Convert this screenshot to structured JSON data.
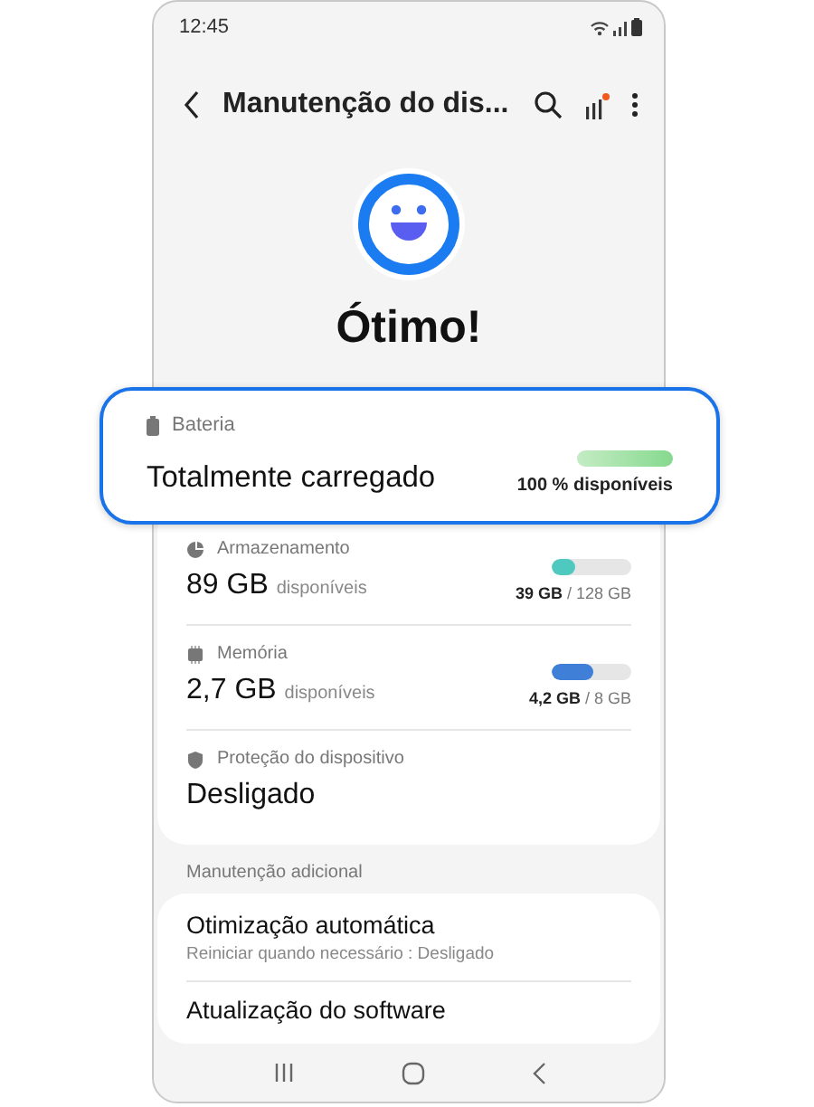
{
  "status_bar": {
    "time": "12:45"
  },
  "header": {
    "title": "Manutenção do dis..."
  },
  "status": {
    "title": "Ótimo!"
  },
  "battery": {
    "label": "Bateria",
    "value": "Totalmente carregado",
    "level": 1,
    "reading": "100 % disponíveis",
    "highlighted": true
  },
  "resources": [
    {
      "kind": "storage",
      "label": "Armazenamento",
      "value": "89 GB",
      "unit": "disponíveis",
      "level": 0.3,
      "color": "#4fc9c0",
      "used": "39 GB",
      "total": "/ 128 GB"
    },
    {
      "kind": "memory",
      "label": "Memória",
      "value": "2,7 GB",
      "unit": "disponíveis",
      "level": 0.52,
      "color": "#3f7fd8",
      "used": "4,2 GB",
      "total": "/ 8 GB"
    },
    {
      "kind": "protection",
      "label": "Proteção do dispositivo",
      "value": "Desligado"
    }
  ],
  "section_title": "Manutenção adicional",
  "more_items": [
    {
      "title": "Otimização automática",
      "subtitle": "Reiniciar quando necessário : Desligado"
    },
    {
      "title": "Atualização do software"
    }
  ]
}
